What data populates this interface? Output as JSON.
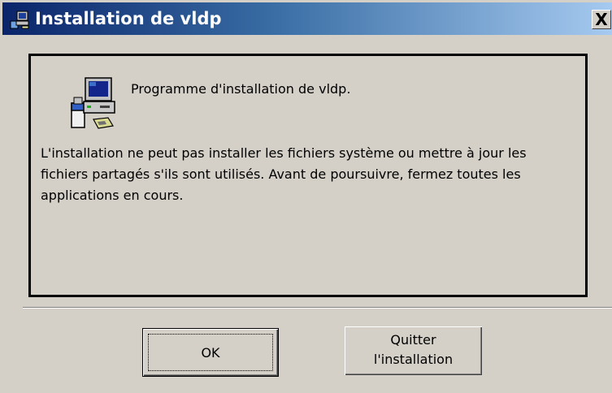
{
  "window": {
    "title": "Installation de vldp",
    "close_label": "X",
    "icons": {
      "app": "setup-installer-icon",
      "close": "close-icon"
    }
  },
  "panel": {
    "icon": "setup-computer-icon",
    "heading": "Programme d'installation de vldp.",
    "message": "L'installation ne peut pas installer les fichiers système ou mettre à jour les fichiers partagés s'ils sont utilisés. Avant de poursuivre, fermez toutes les applications en cours."
  },
  "buttons": {
    "ok_label": "OK",
    "quit_label": "Quitter\nl'installation"
  },
  "colors": {
    "face": "#d4d0c8",
    "title_gradient_start": "#0a246a",
    "title_gradient_end": "#a6caf0",
    "title_text": "#ffffff"
  }
}
